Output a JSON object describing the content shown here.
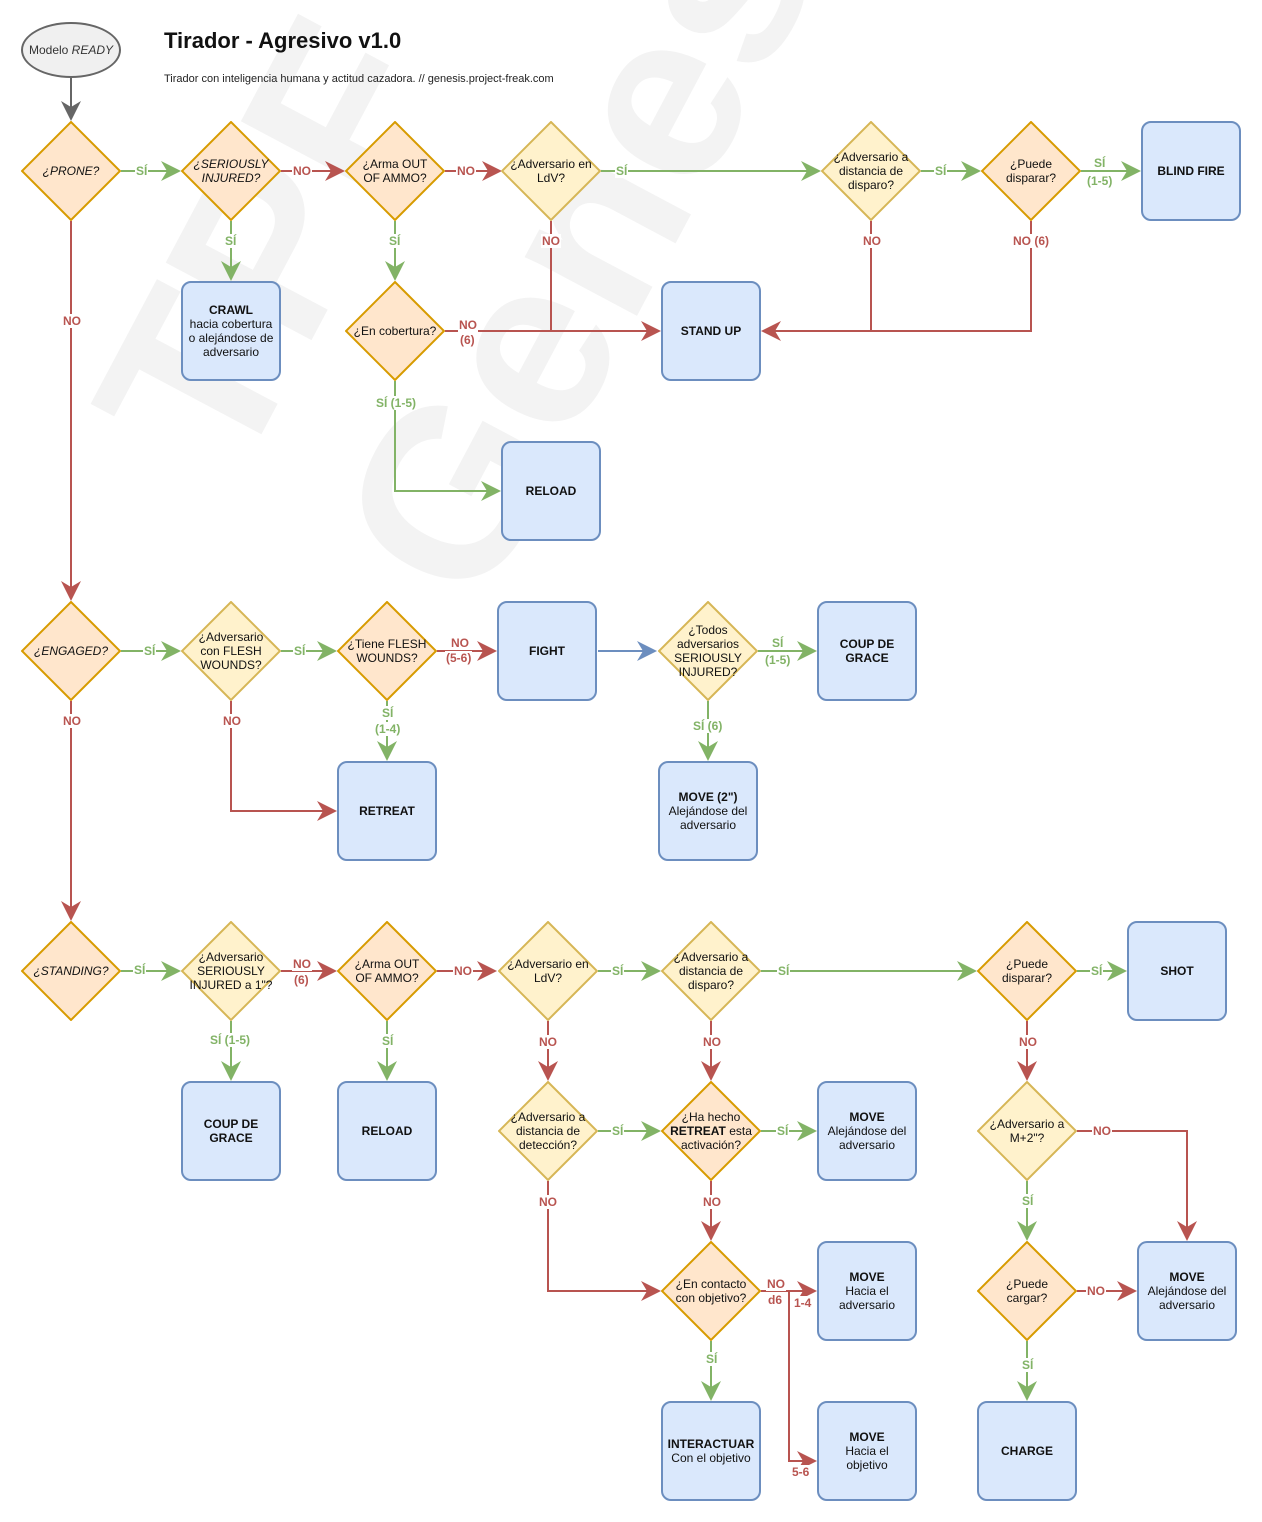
{
  "header": {
    "title": "Tirador - Agresivo v1.0",
    "subtitle": "Tirador con inteligencia humana y actitud cazadora. // genesis.project-freak.com"
  },
  "watermark": "TPF Genesis",
  "colors": {
    "decision_fill_strong": "#ffe6cc",
    "decision_stroke_strong": "#d79b00",
    "decision_fill_light": "#fff2cc",
    "decision_stroke_light": "#d6b656",
    "action_fill": "#dae8fc",
    "action_stroke": "#6c8ebf",
    "yes_color": "#82b366",
    "no_color": "#b85450",
    "neutral_arrow": "#666666"
  },
  "start": {
    "label_a": "Modelo ",
    "label_b": "READY"
  },
  "decisions": {
    "prone": "¿PRONE?",
    "seriously_injured": "¿SERIOUSLY INJURED?",
    "out_of_ammo_1": "¿Arma OUT OF AMMO?",
    "ldv_1": "¿Adversario en LdV?",
    "dist_disparo_1": "¿Adversario a distancia de disparo?",
    "puede_disparar_1": "¿Puede disparar?",
    "en_cobertura": "¿En cobertura?",
    "engaged": "¿ENGAGED?",
    "adv_flesh": "¿Adversario con FLESH WOUNDS?",
    "tiene_flesh": "¿Tiene FLESH WOUNDS?",
    "todos_serious": "¿Todos adversarios SERIOUSLY INJURED?",
    "standing": "¿STANDING?",
    "adv_serious_1": "¿Adversario SERIOUSLY INJURED a 1\"?",
    "out_of_ammo_2": "¿Arma OUT OF AMMO?",
    "ldv_2": "¿Adversario en LdV?",
    "dist_disparo_2": "¿Adversario a distancia de disparo?",
    "puede_disparar_2": "¿Puede disparar?",
    "dist_deteccion": "¿Adversario a distancia de detección?",
    "retreat_hecho_a": "¿Ha hecho ",
    "retreat_hecho_b": "RETREAT",
    "retreat_hecho_c": " esta activación?",
    "adv_m2": "¿Adversario a M+2\"?",
    "en_contacto": "¿En contacto con objetivo?",
    "puede_cargar": "¿Puede cargar?"
  },
  "actions": {
    "blind_fire": {
      "title": "BLIND FIRE",
      "desc": ""
    },
    "crawl": {
      "title": "CRAWL",
      "desc": "hacia cobertura o alejándose de adversario"
    },
    "stand_up": {
      "title": "STAND UP",
      "desc": ""
    },
    "reload_1": {
      "title": "RELOAD",
      "desc": ""
    },
    "fight": {
      "title": "FIGHT",
      "desc": ""
    },
    "coup_1": {
      "title": "COUP DE GRACE",
      "desc": ""
    },
    "retreat": {
      "title": "RETREAT",
      "desc": ""
    },
    "move_2in": {
      "title": "MOVE (2\")",
      "desc": "Alejándose del adversario"
    },
    "coup_2": {
      "title": "COUP DE GRACE",
      "desc": ""
    },
    "reload_2": {
      "title": "RELOAD",
      "desc": ""
    },
    "shot": {
      "title": "SHOT",
      "desc": ""
    },
    "move_alejandose_1": {
      "title": "MOVE",
      "desc": "Alejándose del adversario"
    },
    "move_hacia_adv": {
      "title": "MOVE",
      "desc": "Hacia el adversario"
    },
    "move_alejandose_2": {
      "title": "MOVE",
      "desc": "Alejándose del adversario"
    },
    "interactuar": {
      "title": "INTERACTUAR",
      "desc": "Con el objetivo"
    },
    "move_hacia_obj": {
      "title": "MOVE",
      "desc": "Hacia el objetivo"
    },
    "charge": {
      "title": "CHARGE",
      "desc": ""
    }
  },
  "edge_labels": {
    "si": "SÍ",
    "no": "NO",
    "si_1_5": "SÍ (1-5)",
    "si_1_5_short": "(1-5)",
    "no_6": "NO (6)",
    "no_6_paren": "(6)",
    "no_5_6": "(5-6)",
    "si_1_4": "(1-4)",
    "si_6": "SÍ (6)",
    "d6": "d6",
    "r_1_4": "1-4",
    "r_5_6": "5-6"
  }
}
